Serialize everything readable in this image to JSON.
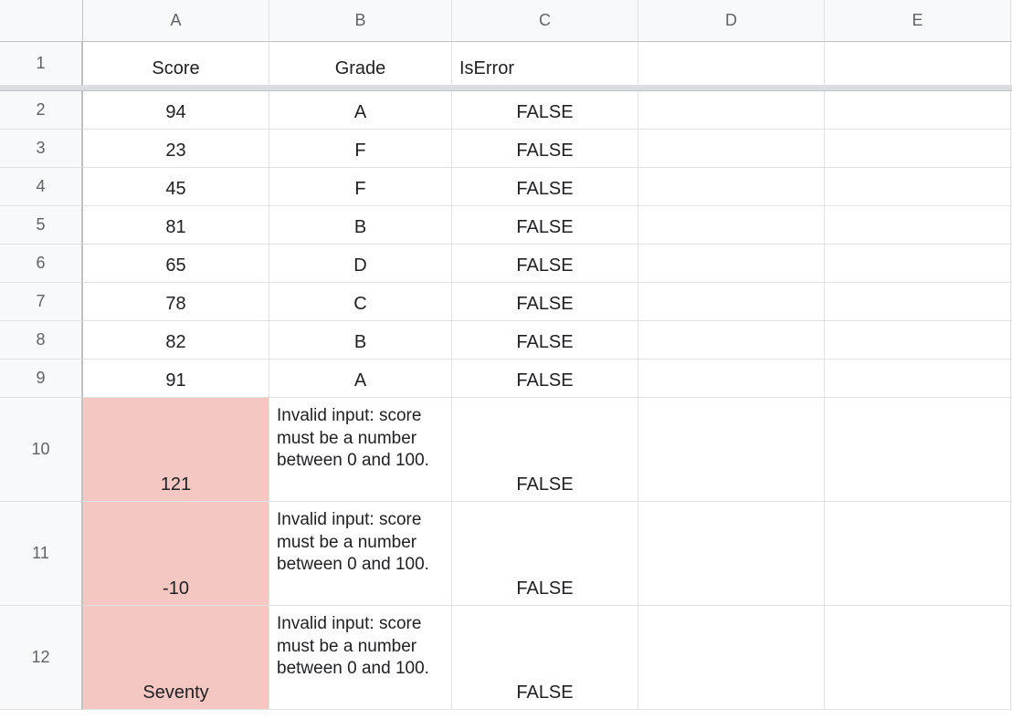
{
  "columns": [
    "A",
    "B",
    "C",
    "D",
    "E"
  ],
  "header_row": {
    "A": "Score",
    "B": "Grade",
    "C": "IsError"
  },
  "error_message": "Invalid input: score must be a number between 0 and 100.",
  "chart_data": {
    "type": "table",
    "columns": [
      "Score",
      "Grade",
      "IsError"
    ],
    "rows": [
      {
        "Score": "94",
        "Grade": "A",
        "IsError": "FALSE"
      },
      {
        "Score": "23",
        "Grade": "F",
        "IsError": "FALSE"
      },
      {
        "Score": "45",
        "Grade": "F",
        "IsError": "FALSE"
      },
      {
        "Score": "81",
        "Grade": "B",
        "IsError": "FALSE"
      },
      {
        "Score": "65",
        "Grade": "D",
        "IsError": "FALSE"
      },
      {
        "Score": "78",
        "Grade": "C",
        "IsError": "FALSE"
      },
      {
        "Score": "82",
        "Grade": "B",
        "IsError": "FALSE"
      },
      {
        "Score": "91",
        "Grade": "A",
        "IsError": "FALSE"
      },
      {
        "Score": "121",
        "Grade": "Invalid input: score must be a number between 0 and 100.",
        "IsError": "FALSE",
        "error": true
      },
      {
        "Score": "-10",
        "Grade": "Invalid input: score must be a number between 0 and 100.",
        "IsError": "FALSE",
        "error": true
      },
      {
        "Score": "Seventy",
        "Grade": "Invalid input: score must be a number between 0 and 100.",
        "IsError": "FALSE",
        "error": true
      }
    ]
  },
  "row_numbers": [
    "1",
    "2",
    "3",
    "4",
    "5",
    "6",
    "7",
    "8",
    "9",
    "10",
    "11",
    "12"
  ]
}
